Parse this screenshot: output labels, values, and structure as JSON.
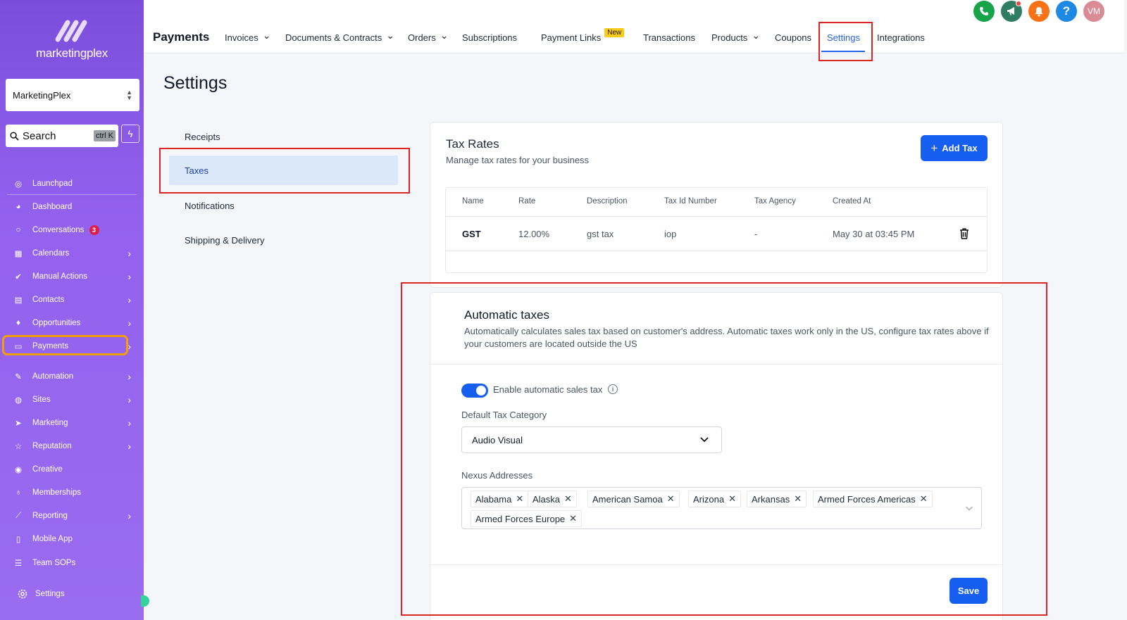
{
  "sidebar": {
    "logo_text": "marketingplex",
    "account": "MarketingPlex",
    "search": {
      "label": "Search",
      "shortcut": "ctrl K"
    },
    "items": [
      {
        "label": "Launchpad",
        "icon": "rocket-icon",
        "chevron": false
      },
      {
        "label": "Dashboard",
        "icon": "dashboard-icon",
        "chevron": false
      },
      {
        "label": "Conversations",
        "icon": "chat-icon",
        "chevron": false,
        "badge": "3"
      },
      {
        "label": "Calendars",
        "icon": "calendar-icon",
        "chevron": true
      },
      {
        "label": "Manual Actions",
        "icon": "check-circle-icon",
        "chevron": true
      },
      {
        "label": "Contacts",
        "icon": "contacts-icon",
        "chevron": true
      },
      {
        "label": "Opportunities",
        "icon": "flame-icon",
        "chevron": true
      },
      {
        "label": "Payments",
        "icon": "card-icon",
        "chevron": true,
        "active": true
      },
      {
        "label": "Automation",
        "icon": "wand-icon",
        "chevron": true
      },
      {
        "label": "Sites",
        "icon": "globe-icon",
        "chevron": true
      },
      {
        "label": "Marketing",
        "icon": "send-icon",
        "chevron": true
      },
      {
        "label": "Reputation",
        "icon": "star-icon",
        "chevron": true
      },
      {
        "label": "Creative",
        "icon": "palette-icon",
        "chevron": false
      },
      {
        "label": "Memberships",
        "icon": "award-icon",
        "chevron": false
      },
      {
        "label": "Reporting",
        "icon": "chart-icon",
        "chevron": true
      },
      {
        "label": "Mobile App",
        "icon": "phone-icon",
        "chevron": false
      },
      {
        "label": "Team SOPs",
        "icon": "list-icon",
        "chevron": false
      }
    ],
    "settings_label": "Settings"
  },
  "topbar": {
    "title": "Payments",
    "tabs": [
      {
        "label": "Invoices",
        "caret": true
      },
      {
        "label": "Documents & Contracts",
        "caret": true
      },
      {
        "label": "Orders",
        "caret": true
      },
      {
        "label": "Subscriptions",
        "caret": false
      },
      {
        "label": "Payment Links",
        "caret": false,
        "badge": "New"
      },
      {
        "label": "Transactions",
        "caret": false
      },
      {
        "label": "Products",
        "caret": true
      },
      {
        "label": "Coupons",
        "caret": false
      },
      {
        "label": "Settings",
        "caret": false,
        "active": true
      },
      {
        "label": "Integrations",
        "caret": false
      }
    ],
    "avatar_initials": "VM",
    "icon_colors": {
      "phone": "#16a34a",
      "megaphone": "#2f7d62",
      "bell": "#f97316",
      "help": "#1e88e5",
      "avatar": "#d98c95"
    }
  },
  "page": {
    "heading": "Settings",
    "settings_nav": [
      "Receipts",
      "Taxes",
      "Notifications",
      "Shipping & Delivery"
    ],
    "active_nav": "Taxes"
  },
  "tax_rates": {
    "title": "Tax Rates",
    "subtitle": "Manage tax rates for your business",
    "add_button": "Add Tax",
    "columns": [
      "Name",
      "Rate",
      "Description",
      "Tax Id Number",
      "Tax Agency",
      "Created At"
    ],
    "rows": [
      {
        "name": "GST",
        "rate": "12.00%",
        "description": "gst tax",
        "tax_id": "iop",
        "agency": "-",
        "created": "May 30 at 03:45 PM"
      }
    ]
  },
  "automatic_taxes": {
    "title": "Automatic taxes",
    "description": "Automatically calculates sales tax based on customer's address. Automatic taxes work only in the US, configure tax rates above if your customers are located outside the US",
    "toggle_label": "Enable automatic sales tax",
    "toggle_on": true,
    "category_label": "Default Tax Category",
    "category_value": "Audio Visual",
    "nexus_label": "Nexus Addresses",
    "nexus": [
      "Alabama",
      "Alaska",
      "American Samoa",
      "Arizona",
      "Arkansas",
      "Armed Forces Americas",
      "Armed Forces Europe"
    ],
    "save_button": "Save"
  },
  "accent_color": "#155eef"
}
